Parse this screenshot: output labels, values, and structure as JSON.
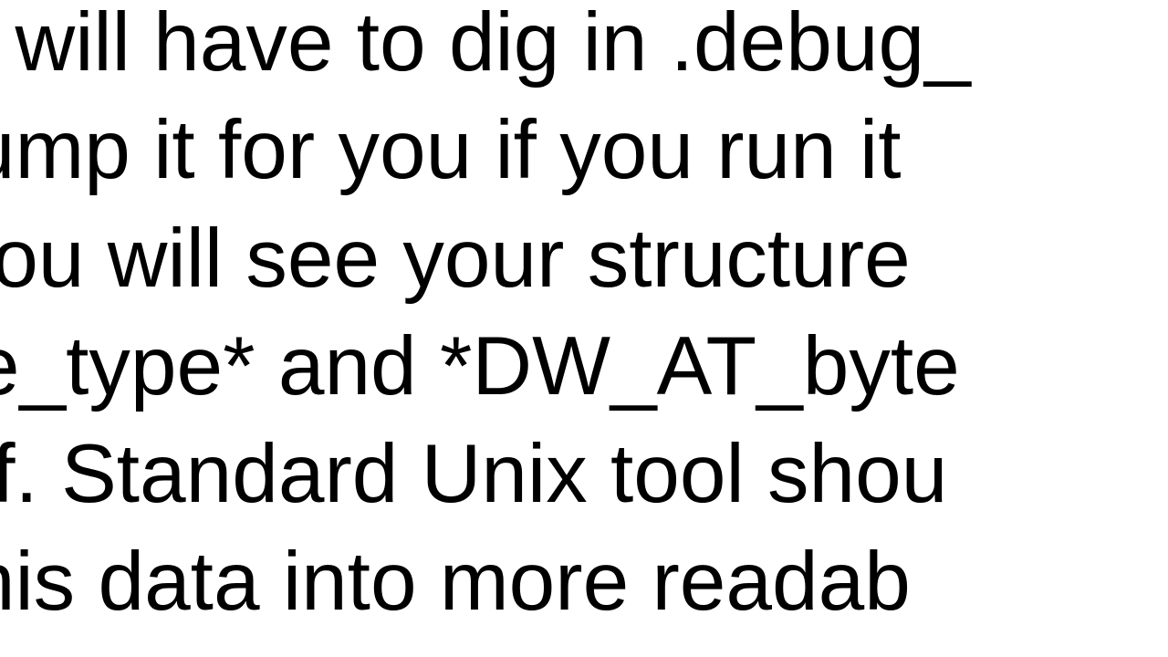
{
  "lines": {
    "l1": "ou will have to dig in .debug_",
    "l2": " dump it for you if you run it",
    "l3": ". You will see your structure",
    "l4": "ure_type* and *DW_AT_byte",
    "l5": "eof. Standard Unix tool shou",
    "l6": "t this data into more readab"
  }
}
